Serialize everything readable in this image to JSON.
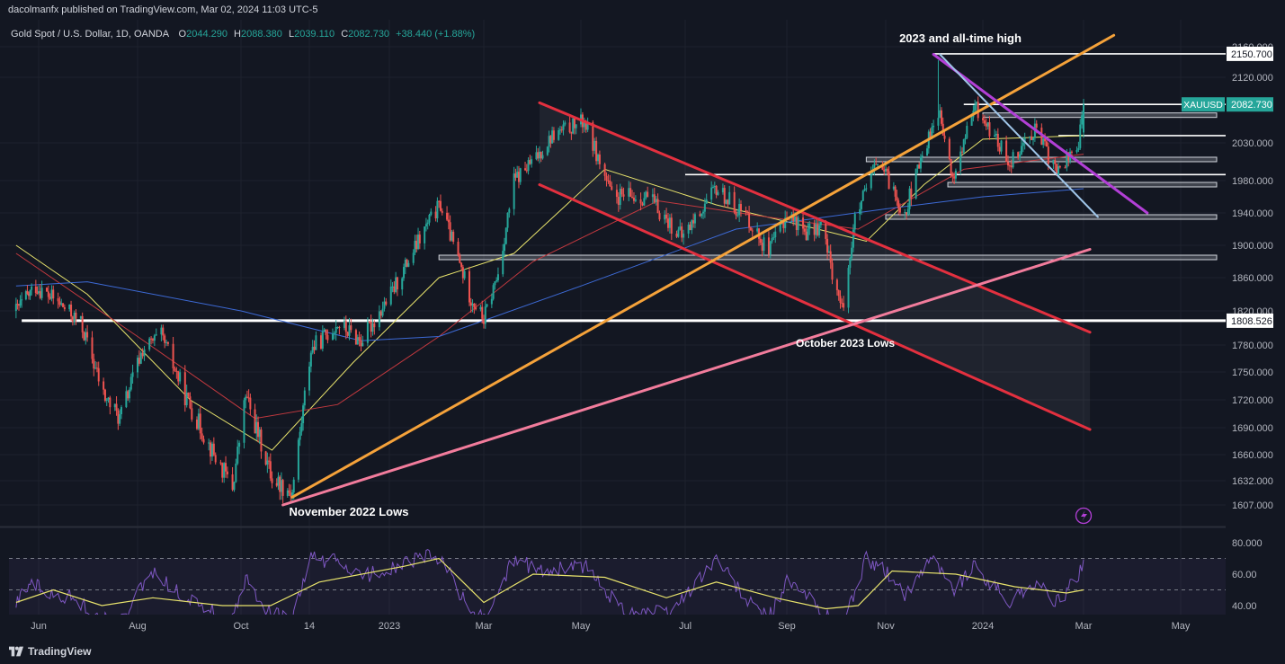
{
  "header": {
    "published": "dacolmanfx published on TradingView.com, Mar 02, 2024 11:03 UTC-5"
  },
  "symbol_line": {
    "name": "Gold Spot / U.S. Dollar, 1D, OANDA",
    "o_label": "O",
    "o": "2044.290",
    "h_label": "H",
    "h": "2088.380",
    "l_label": "L",
    "l": "2039.110",
    "c_label": "C",
    "c": "2082.730",
    "change": "+38.440 (+1.88%)"
  },
  "annotations": {
    "ath": "2023 and all-time high",
    "oct_lows": "October 2023 Lows",
    "nov_lows": "November 2022 Lows"
  },
  "footer": {
    "brand": "TradingView"
  },
  "colors": {
    "background": "#131722",
    "up": "#26a69a",
    "down": "#ef5350",
    "ma_yellow": "#e8e36c",
    "ma_red": "#c2393f",
    "ma_blue": "#3d6ad6",
    "channel_red": "#e3303f",
    "trend_orange": "#f5a23a",
    "trend_pink": "#f27c9c",
    "trend_purple": "#b23fd6",
    "trend_lightblue": "#9fc5e8",
    "rsi": "#7e57c2"
  },
  "chart_data": [
    {
      "type": "candlestick",
      "title": "Gold Spot / U.S. Dollar, 1D, OANDA",
      "symbol": "XAUUSD",
      "last_price": 2082.73,
      "x_ticks": [
        "Jun",
        "Aug",
        "Oct",
        "14",
        "2023",
        "Mar",
        "May",
        "Jul",
        "Sep",
        "Nov",
        "2024",
        "Mar",
        "May"
      ],
      "y_ticks": [
        2160,
        2120,
        2030,
        1980,
        1940,
        1900,
        1860,
        1820,
        1780,
        1750,
        1720,
        1690,
        1660,
        1632,
        1607
      ],
      "y_tick_labels": [
        "2160.000",
        "2120.000",
        "2030.000",
        "1980.000",
        "1940.000",
        "1900.000",
        "1860.000",
        "1820.000",
        "1780.000",
        "1750.000",
        "1720.000",
        "1690.000",
        "1660.000",
        "1632.000",
        "1607.000"
      ],
      "price_labels": [
        {
          "text": "2150.700",
          "value": 2150.7,
          "style": "white"
        },
        {
          "text": "2082.730",
          "value": 2082.73,
          "style": "symbol",
          "symbol": "XAUUSD"
        },
        {
          "text": "1808.526",
          "value": 1808.526,
          "style": "white"
        }
      ],
      "close_path": [
        [
          "2022-05-16",
          1820
        ],
        [
          "2022-05-30",
          1850
        ],
        [
          "2022-06-13",
          1830
        ],
        [
          "2022-06-27",
          1805
        ],
        [
          "2022-07-11",
          1725
        ],
        [
          "2022-07-21",
          1700
        ],
        [
          "2022-08-04",
          1775
        ],
        [
          "2022-08-15",
          1790
        ],
        [
          "2022-08-29",
          1725
        ],
        [
          "2022-09-15",
          1660
        ],
        [
          "2022-09-26",
          1625
        ],
        [
          "2022-10-04",
          1725
        ],
        [
          "2022-10-21",
          1635
        ],
        [
          "2022-11-03",
          1620
        ],
        [
          "2022-11-15",
          1775
        ],
        [
          "2022-12-01",
          1805
        ],
        [
          "2022-12-15",
          1785
        ],
        [
          "2023-01-02",
          1840
        ],
        [
          "2023-01-26",
          1930
        ],
        [
          "2023-02-02",
          1950
        ],
        [
          "2023-02-20",
          1840
        ],
        [
          "2023-03-01",
          1810
        ],
        [
          "2023-03-10",
          1865
        ],
        [
          "2023-03-20",
          1980
        ],
        [
          "2023-04-03",
          2010
        ],
        [
          "2023-04-13",
          2040
        ],
        [
          "2023-05-03",
          2060
        ],
        [
          "2023-05-19",
          1960
        ],
        [
          "2023-06-09",
          1960
        ],
        [
          "2023-06-29",
          1910
        ],
        [
          "2023-07-20",
          1970
        ],
        [
          "2023-08-08",
          1935
        ],
        [
          "2023-08-21",
          1890
        ],
        [
          "2023-09-01",
          1940
        ],
        [
          "2023-09-14",
          1915
        ],
        [
          "2023-09-22",
          1925
        ],
        [
          "2023-10-05",
          1820
        ],
        [
          "2023-10-13",
          1930
        ],
        [
          "2023-10-27",
          2005
        ],
        [
          "2023-11-13",
          1940
        ],
        [
          "2023-11-29",
          2045
        ],
        [
          "2023-12-04",
          2075
        ],
        [
          "2023-12-13",
          1980
        ],
        [
          "2023-12-27",
          2080
        ],
        [
          "2024-01-17",
          2005
        ],
        [
          "2024-02-01",
          2050
        ],
        [
          "2024-02-14",
          1990
        ],
        [
          "2024-02-27",
          2030
        ],
        [
          "2024-03-01",
          2082.73
        ]
      ],
      "moving_averages": [
        {
          "color": "#e8e36c",
          "points": [
            [
              "2022-05-16",
              1900
            ],
            [
              "2022-07-01",
              1840
            ],
            [
              "2022-09-01",
              1720
            ],
            [
              "2022-10-21",
              1665
            ],
            [
              "2022-12-10",
              1760
            ],
            [
              "2023-02-01",
              1860
            ],
            [
              "2023-03-20",
              1890
            ],
            [
              "2023-05-15",
              1995
            ],
            [
              "2023-07-20",
              1950
            ],
            [
              "2023-09-20",
              1920
            ],
            [
              "2023-10-20",
              1905
            ],
            [
              "2023-11-25",
              1975
            ],
            [
              "2024-01-01",
              2035
            ],
            [
              "2024-03-01",
              2040
            ]
          ]
        },
        {
          "color": "#c2393f",
          "points": [
            [
              "2022-05-16",
              1890
            ],
            [
              "2022-08-01",
              1790
            ],
            [
              "2022-10-10",
              1700
            ],
            [
              "2022-12-01",
              1715
            ],
            [
              "2023-02-01",
              1790
            ],
            [
              "2023-04-01",
              1880
            ],
            [
              "2023-06-15",
              1955
            ],
            [
              "2023-08-20",
              1935
            ],
            [
              "2023-10-15",
              1920
            ],
            [
              "2023-12-20",
              1995
            ],
            [
              "2024-03-01",
              2015
            ]
          ]
        },
        {
          "color": "#3d6ad6",
          "points": [
            [
              "2022-05-16",
              1850
            ],
            [
              "2022-07-01",
              1855
            ],
            [
              "2022-10-01",
              1820
            ],
            [
              "2022-12-15",
              1785
            ],
            [
              "2023-02-01",
              1790
            ],
            [
              "2023-05-01",
              1850
            ],
            [
              "2023-08-01",
              1920
            ],
            [
              "2023-11-01",
              1945
            ],
            [
              "2024-01-01",
              1960
            ],
            [
              "2024-03-01",
              1970
            ]
          ]
        }
      ],
      "trendlines": [
        {
          "color": "#e3303f",
          "from": [
            "2023-04-05",
            2085
          ],
          "to": [
            "2024-03-05",
            1795
          ]
        },
        {
          "color": "#e3303f",
          "from": [
            "2023-04-05",
            1975
          ],
          "to": [
            "2024-03-05",
            1688
          ]
        },
        {
          "color": "#f5a23a",
          "from": [
            "2022-11-03",
            1615
          ],
          "to": [
            "2024-03-20",
            2175
          ]
        },
        {
          "color": "#f27c9c",
          "from": [
            "2022-10-28",
            1607
          ],
          "to": [
            "2024-03-05",
            1895
          ]
        },
        {
          "color": "#b23fd6",
          "from": [
            "2023-12-01",
            2150
          ],
          "to": [
            "2024-04-10",
            1940
          ]
        },
        {
          "color": "#9fc5e8",
          "from": [
            "2023-12-05",
            2150
          ],
          "to": [
            "2024-03-10",
            1935
          ]
        }
      ],
      "horizontal_levels": [
        {
          "value": 2150.7,
          "from": "2023-12-01",
          "width": "thin"
        },
        {
          "value": 2082.73,
          "from": "2023-12-20",
          "width": "thin"
        },
        {
          "value": 2068,
          "from": "2024-01-01",
          "width": "zone"
        },
        {
          "value": 2040,
          "from": "2024-02-15",
          "width": "thin"
        },
        {
          "value": 2008,
          "from": "2023-10-20",
          "width": "zone"
        },
        {
          "value": 1988,
          "from": "2023-07-01",
          "width": "thin"
        },
        {
          "value": 1975,
          "from": "2023-12-10",
          "width": "zone"
        },
        {
          "value": 1935,
          "from": "2023-11-01",
          "width": "zone"
        },
        {
          "value": 1885,
          "from": "2023-02-01",
          "width": "zone"
        },
        {
          "value": 1808.526,
          "from": "2022-05-20",
          "width": "thick"
        }
      ],
      "annotations": [
        {
          "text": "2023 and all-time high",
          "anchor": [
            "2023-12-04",
            2150
          ]
        },
        {
          "text": "October 2023 Lows",
          "anchor": [
            "2023-10-06",
            1808
          ]
        },
        {
          "text": "November 2022 Lows",
          "anchor": [
            "2022-11-03",
            1607
          ]
        }
      ]
    },
    {
      "type": "line",
      "title": "RSI",
      "y_ticks": [
        80,
        60,
        40
      ],
      "y_tick_labels": [
        "80.000",
        "60.00",
        "40.00"
      ],
      "bands": [
        70,
        50,
        30
      ],
      "rsi": [
        [
          "2022-05-16",
          42
        ],
        [
          "2022-05-26",
          55
        ],
        [
          "2022-06-09",
          48
        ],
        [
          "2022-06-23",
          45
        ],
        [
          "2022-07-07",
          32
        ],
        [
          "2022-07-21",
          28
        ],
        [
          "2022-08-10",
          62
        ],
        [
          "2022-08-22",
          50
        ],
        [
          "2022-09-08",
          40
        ],
        [
          "2022-09-26",
          30
        ],
        [
          "2022-10-04",
          56
        ],
        [
          "2022-10-20",
          35
        ],
        [
          "2022-11-03",
          30
        ],
        [
          "2022-11-15",
          70
        ],
        [
          "2022-12-01",
          68
        ],
        [
          "2022-12-15",
          58
        ],
        [
          "2023-01-05",
          65
        ],
        [
          "2023-01-26",
          72
        ],
        [
          "2023-02-03",
          68
        ],
        [
          "2023-02-22",
          34
        ],
        [
          "2023-03-02",
          32
        ],
        [
          "2023-03-20",
          70
        ],
        [
          "2023-04-05",
          62
        ],
        [
          "2023-05-03",
          65
        ],
        [
          "2023-05-25",
          38
        ],
        [
          "2023-06-22",
          35
        ],
        [
          "2023-07-20",
          70
        ],
        [
          "2023-08-08",
          42
        ],
        [
          "2023-08-21",
          32
        ],
        [
          "2023-09-01",
          55
        ],
        [
          "2023-09-14",
          45
        ],
        [
          "2023-10-05",
          25
        ],
        [
          "2023-10-20",
          70
        ],
        [
          "2023-11-01",
          62
        ],
        [
          "2023-11-13",
          45
        ],
        [
          "2023-11-29",
          73
        ],
        [
          "2023-12-13",
          50
        ],
        [
          "2023-12-27",
          65
        ],
        [
          "2024-01-17",
          42
        ],
        [
          "2024-02-01",
          55
        ],
        [
          "2024-02-14",
          42
        ],
        [
          "2024-02-27",
          58
        ],
        [
          "2024-03-01",
          71
        ]
      ],
      "rsi_ma": [
        [
          "2022-05-16",
          42
        ],
        [
          "2022-06-10",
          50
        ],
        [
          "2022-07-10",
          40
        ],
        [
          "2022-08-10",
          45
        ],
        [
          "2022-09-20",
          40
        ],
        [
          "2022-10-20",
          40
        ],
        [
          "2022-11-20",
          55
        ],
        [
          "2023-01-10",
          65
        ],
        [
          "2023-02-01",
          70
        ],
        [
          "2023-03-01",
          42
        ],
        [
          "2023-04-01",
          60
        ],
        [
          "2023-05-15",
          58
        ],
        [
          "2023-06-20",
          45
        ],
        [
          "2023-07-20",
          55
        ],
        [
          "2023-08-25",
          45
        ],
        [
          "2023-09-25",
          38
        ],
        [
          "2023-10-15",
          40
        ],
        [
          "2023-11-05",
          62
        ],
        [
          "2023-12-15",
          60
        ],
        [
          "2024-01-20",
          52
        ],
        [
          "2024-02-20",
          48
        ],
        [
          "2024-03-01",
          50
        ]
      ]
    }
  ]
}
